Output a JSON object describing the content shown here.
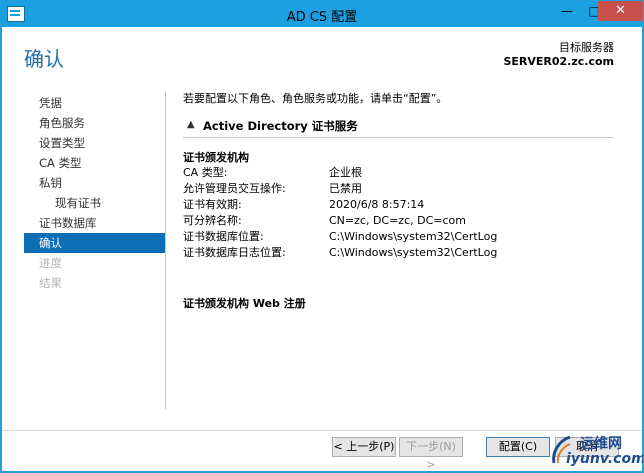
{
  "window": {
    "title": "AD CS 配置",
    "min_glyph": "—",
    "max_glyph": "□",
    "close_glyph": "✕"
  },
  "header": {
    "page_title": "确认",
    "target_label": "目标服务器",
    "target_server": "SERVER02.zc.com"
  },
  "nav": {
    "items": [
      {
        "label": "凭据",
        "state": "normal"
      },
      {
        "label": "角色服务",
        "state": "normal"
      },
      {
        "label": "设置类型",
        "state": "normal"
      },
      {
        "label": "CA 类型",
        "state": "normal"
      },
      {
        "label": "私钥",
        "state": "normal"
      },
      {
        "label": "现有证书",
        "state": "sub"
      },
      {
        "label": "证书数据库",
        "state": "normal"
      },
      {
        "label": "确认",
        "state": "active"
      },
      {
        "label": "进度",
        "state": "disabled"
      },
      {
        "label": "结果",
        "state": "disabled"
      }
    ]
  },
  "content": {
    "intro": "若要配置以下角色、角色服务或功能，请单击“配置”。",
    "section_title": "Active Directory 证书服务",
    "chevron_glyph": "▲",
    "group1_title": "证书颁发机构",
    "props": [
      {
        "key": "CA 类型:",
        "value": "企业根"
      },
      {
        "key": "允许管理员交互操作:",
        "value": "已禁用"
      },
      {
        "key": "证书有效期:",
        "value": "2020/6/8 8:57:14"
      },
      {
        "key": "可分辨名称:",
        "value": "CN=zc, DC=zc, DC=com"
      },
      {
        "key": "证书数据库位置:",
        "value": "C:\\Windows\\system32\\CertLog"
      },
      {
        "key": "证书数据库日志位置:",
        "value": "C:\\Windows\\system32\\CertLog"
      }
    ],
    "group2_title": "证书颁发机构 Web 注册"
  },
  "buttons": {
    "prev": "< 上一步(P)",
    "next": "下一步(N) >",
    "configure": "配置(C)",
    "cancel": "取消"
  },
  "watermark": {
    "top": "运维网",
    "bottom": "iyunv.com"
  },
  "colors": {
    "titlebar": "#1ba1e2",
    "close": "#c7504a",
    "active_nav": "#0d6db5",
    "page_title": "#1f6fa8"
  }
}
